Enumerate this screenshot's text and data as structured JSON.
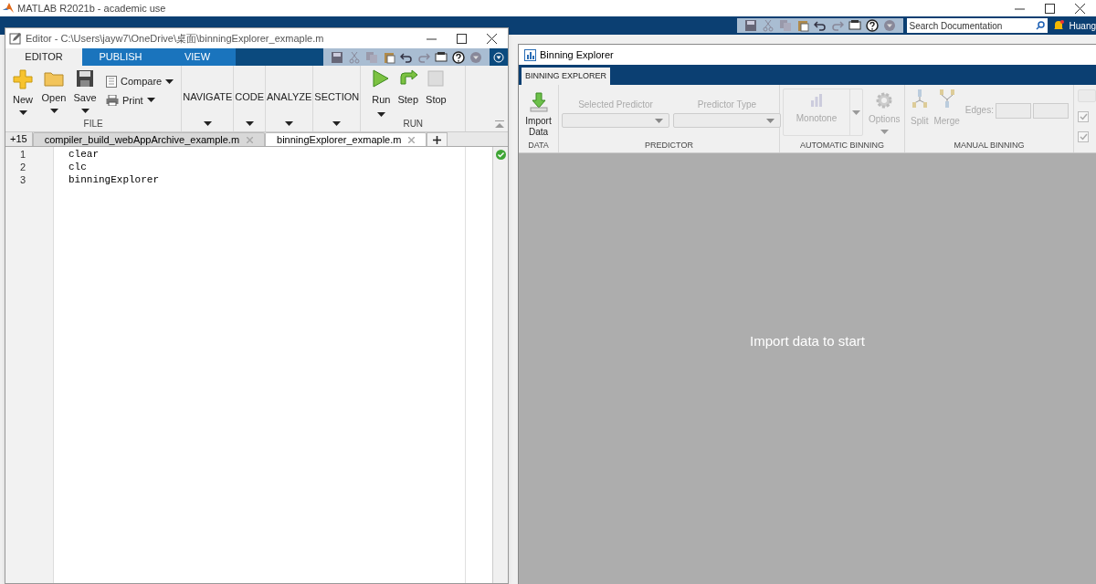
{
  "main_window": {
    "title": "MATLAB R2021b - academic use",
    "search": {
      "placeholder": "Search Documentation"
    },
    "user": "Huang"
  },
  "editor": {
    "title": "Editor - C:\\Users\\jayw7\\OneDrive\\桌面\\binningExplorer_exmaple.m",
    "tabs": [
      {
        "label": "EDITOR",
        "selected": true
      },
      {
        "label": "PUBLISH",
        "selected": false
      },
      {
        "label": "VIEW",
        "selected": false
      }
    ],
    "file_group": {
      "label": "FILE",
      "buttons": [
        {
          "label": "New"
        },
        {
          "label": "Open"
        },
        {
          "label": "Save"
        }
      ],
      "small_buttons": [
        {
          "label": "Compare"
        },
        {
          "label": "Print"
        }
      ]
    },
    "menus": [
      {
        "label": "NAVIGATE"
      },
      {
        "label": "CODE"
      },
      {
        "label": "ANALYZE"
      },
      {
        "label": "SECTION"
      }
    ],
    "run_group": {
      "label": "RUN",
      "buttons": [
        {
          "label": "Run",
          "dropdown": true
        },
        {
          "label": "Step",
          "dropdown": false
        },
        {
          "label": "Stop",
          "dropdown": false
        }
      ]
    },
    "file_tabs_more": "+15",
    "file_tabs": [
      {
        "label": "compiler_build_webAppArchive_example.m",
        "selected": false
      },
      {
        "label": "binningExplorer_exmaple.m",
        "selected": true
      }
    ],
    "lines": [
      {
        "number": "1",
        "code": "clear"
      },
      {
        "number": "2",
        "code": "clc"
      },
      {
        "number": "3",
        "code": "binningExplorer"
      }
    ]
  },
  "binning_explorer": {
    "title": "Binning Explorer",
    "tabs": [
      {
        "label": "BINNING EXPLORER",
        "selected": true
      }
    ],
    "data_group": {
      "label": "DATA",
      "button": "Import Data"
    },
    "predictor_group": {
      "label": "PREDICTOR",
      "dropdowns": [
        {
          "label": "Selected Predictor",
          "disabled": true
        },
        {
          "label": "Predictor Type",
          "disabled": true
        }
      ]
    },
    "automatic_group": {
      "label": "AUTOMATIC BINNING",
      "algorithm": {
        "label": "Monotone",
        "disabled": true
      },
      "options": {
        "label": "Options",
        "disabled": true
      }
    },
    "manual_group": {
      "label": "MANUAL BINNING",
      "buttons": [
        {
          "label": "Split",
          "disabled": true
        },
        {
          "label": "Merge",
          "disabled": true
        }
      ],
      "edges_label": "Edges:"
    },
    "checkboxes": [
      {
        "checked": true
      },
      {
        "checked": true
      }
    ],
    "message": "Import data to start"
  }
}
